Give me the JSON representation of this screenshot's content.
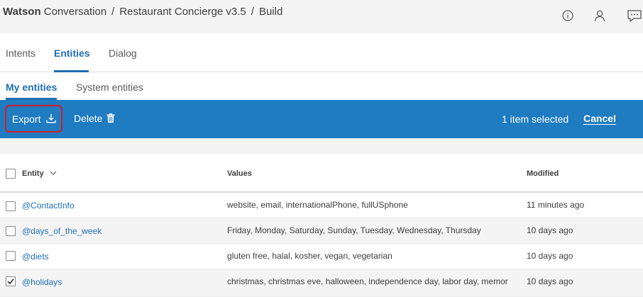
{
  "header": {
    "brand_bold": "Watson",
    "brand_rest": " Conversation",
    "sep1": "/",
    "workspace": "Restaurant Concierge v3.5",
    "sep2": "/",
    "page": "Build",
    "icons": [
      "info-icon",
      "user-icon",
      "chat-icon"
    ]
  },
  "tabs": [
    {
      "label": "Intents",
      "active": false
    },
    {
      "label": "Entities",
      "active": true
    },
    {
      "label": "Dialog",
      "active": false
    }
  ],
  "subtabs": [
    {
      "label": "My entities",
      "active": true
    },
    {
      "label": "System entities",
      "active": false
    }
  ],
  "action_bar": {
    "export_label": "Export",
    "delete_label": "Delete",
    "selection_text": "1 item selected",
    "cancel_label": "Cancel",
    "export_icon": "download-icon",
    "delete_icon": "trash-icon",
    "bar_color": "#1f7cc1",
    "highlight_color": "#d21e2b"
  },
  "table": {
    "columns": {
      "entity": "Entity",
      "values": "Values",
      "modified": "Modified"
    },
    "rows": [
      {
        "entity": "@ContactInfo",
        "values": "website, email, internationalPhone, fullUSphone",
        "modified": "11 minutes ago",
        "checked": false
      },
      {
        "entity": "@days_of_the_week",
        "values": "Friday, Monday, Saturday, Sunday, Tuesday, Wednesday, Thursday",
        "modified": "10 days ago",
        "checked": false
      },
      {
        "entity": "@diets",
        "values": "gluten free, halal, kosher, vegan, vegetarian",
        "modified": "10 days ago",
        "checked": false
      },
      {
        "entity": "@holidays",
        "values": "christmas, christmas eve, halloween, independence day, labor day, memori",
        "modified": "10 days ago",
        "checked": true
      }
    ]
  }
}
